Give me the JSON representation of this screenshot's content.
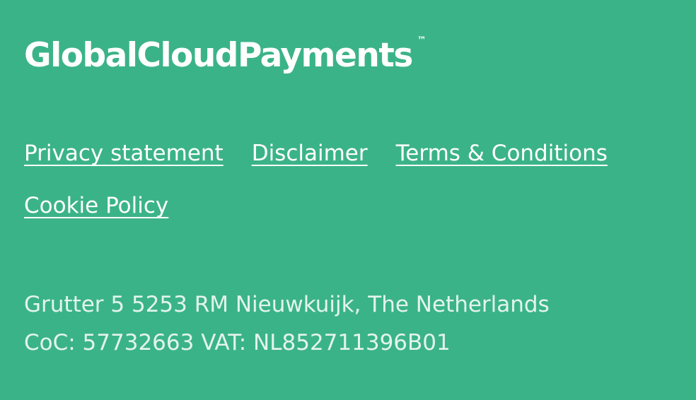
{
  "brand": {
    "name": "GlobalCloudPayments",
    "trademark": "™"
  },
  "links": {
    "privacy": "Privacy statement",
    "disclaimer": "Disclaimer",
    "terms": "Terms & Conditions",
    "cookie": "Cookie Policy"
  },
  "company": {
    "address_line": "Grutter 5 5253 RM Nieuwkuijk, The Netherlands",
    "registration_line": "CoC: 57732663 VAT: NL852711396B01"
  },
  "colors": {
    "background": "#3bb389",
    "text": "#ffffff",
    "muted_text": "#e3f4ec"
  }
}
